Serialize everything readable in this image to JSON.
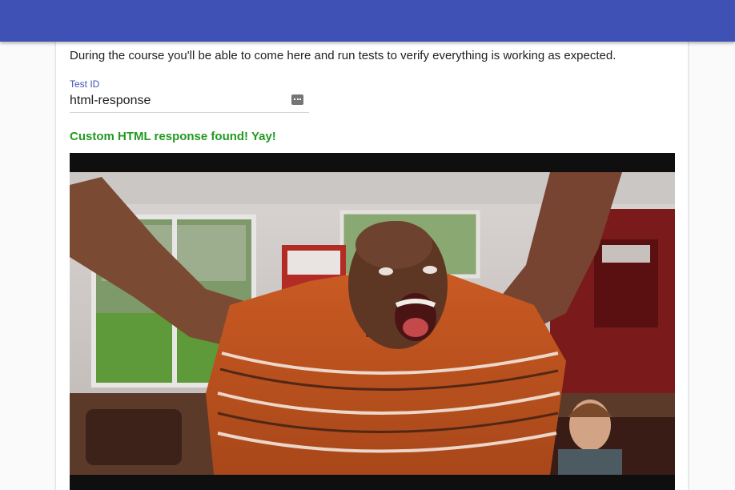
{
  "intro": {
    "text": "During the course you'll be able to come here and run tests to verify everything is working as expected."
  },
  "test_field": {
    "label": "Test ID",
    "value": "html-response"
  },
  "result": {
    "message": "Custom HTML response found! Yay!"
  },
  "icons": {
    "field_action": "more-horiz-icon"
  },
  "colors": {
    "app_bar": "#3f51b5",
    "label": "#3f51b5",
    "success": "#219a22"
  }
}
